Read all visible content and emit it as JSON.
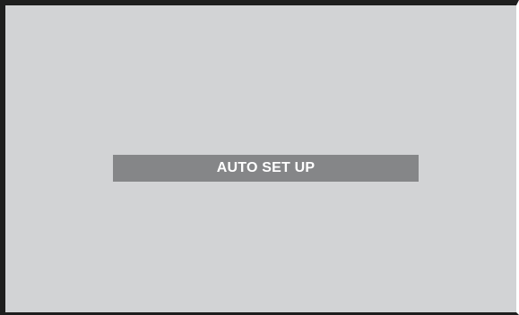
{
  "screen": {
    "background_color": "#d2d3d5",
    "frame_color": "#1e1e1e"
  },
  "osd": {
    "message": "AUTO SET UP",
    "banner_color": "#858688",
    "text_color": "#ffffff"
  }
}
